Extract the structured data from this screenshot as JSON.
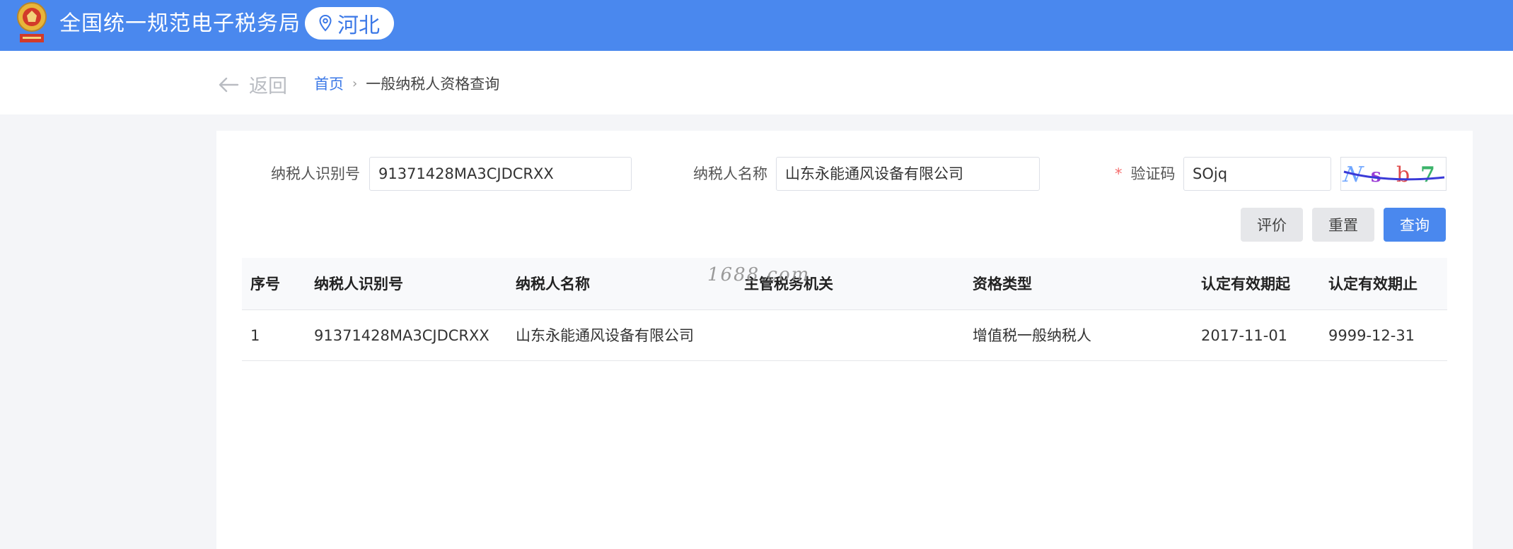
{
  "header": {
    "site_title": "全国统一规范电子税务局",
    "region": "河北",
    "emblem_icon": "tax-emblem-icon",
    "location_icon": "location-pin-icon",
    "brand_color": "#4a88ee"
  },
  "breadcrumb": {
    "back_label": "返回",
    "home": "首页",
    "current": "一般纳税人资格查询"
  },
  "form": {
    "taxpayer_id_label": "纳税人识别号",
    "taxpayer_id_value": "91371428MA3CJDCRXX",
    "taxpayer_name_label": "纳税人名称",
    "taxpayer_name_value": "山东永能通风设备有限公司",
    "captcha_required_mark": "*",
    "captcha_label": "验证码",
    "captcha_value": "SOjq",
    "captcha_image_text": "Nsb7"
  },
  "buttons": {
    "evaluate": "评价",
    "reset": "重置",
    "query": "查询"
  },
  "table": {
    "headers": [
      "序号",
      "纳税人识别号",
      "纳税人名称",
      "主管税务机关",
      "资格类型",
      "认定有效期起",
      "认定有效期止"
    ],
    "rows": [
      [
        "1",
        "91371428MA3CJDCRXX",
        "山东永能通风设备有限公司",
        "",
        "增值税一般纳税人",
        "2017-11-01",
        "9999-12-31"
      ]
    ]
  },
  "watermark": "1688.com"
}
